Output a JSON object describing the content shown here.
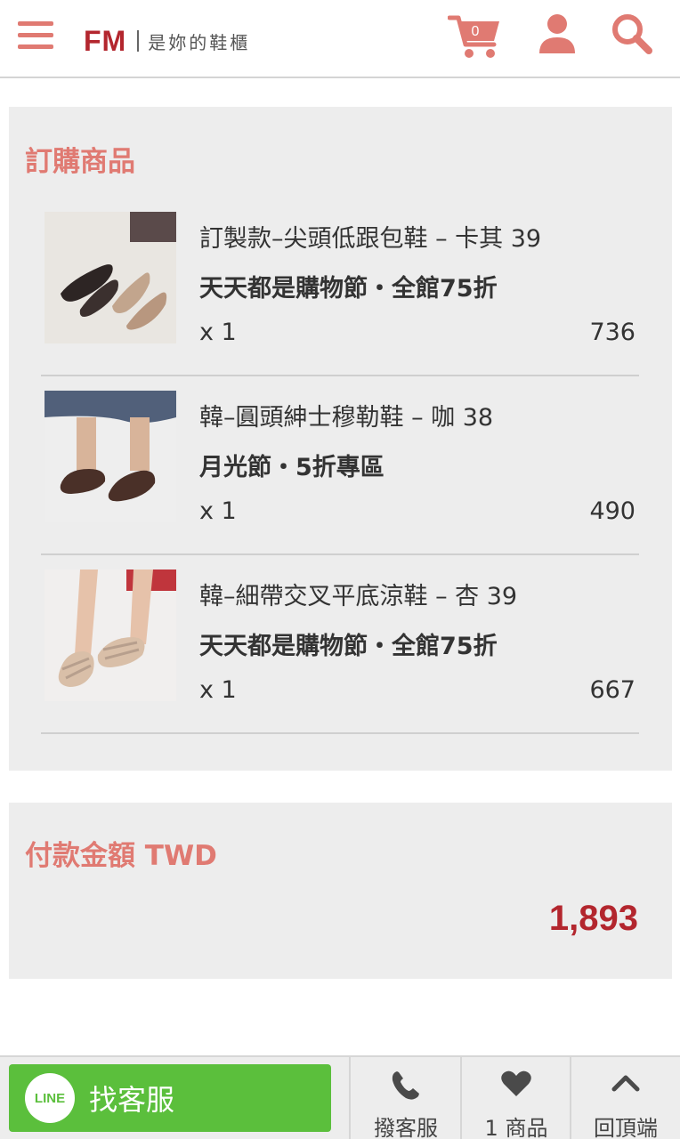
{
  "header": {
    "brand": "FM",
    "tagline": "是妳的鞋櫃",
    "cart_count": "0",
    "accent_color": "#e07a72",
    "brand_color": "#b3262e",
    "icons": [
      "menu-icon",
      "cart-icon",
      "user-icon",
      "search-icon"
    ]
  },
  "order": {
    "title": "訂購商品",
    "items": [
      {
        "name": "訂製款–尖頭低跟包鞋 – 卡其 39",
        "promo": "天天都是購物節・全館75折",
        "qty": "x 1",
        "price": "736"
      },
      {
        "name": "韓–圓頭紳士穆勒鞋 – 咖 38",
        "promo": "月光節・5折專區",
        "qty": "x 1",
        "price": "490"
      },
      {
        "name": "韓–細帶交叉平底涼鞋 – 杏 39",
        "promo": "天天都是購物節・全館75折",
        "qty": "x 1",
        "price": "667"
      }
    ]
  },
  "payment": {
    "title": "付款金額 TWD",
    "total": "1,893",
    "total_color": "#b3262e"
  },
  "bottom_bar": {
    "line_badge": "LINE",
    "line_label": "找客服",
    "line_color": "#5bbf3c",
    "call_label": "撥客服",
    "fav_label": "1 商品",
    "top_label": "回頂端"
  }
}
